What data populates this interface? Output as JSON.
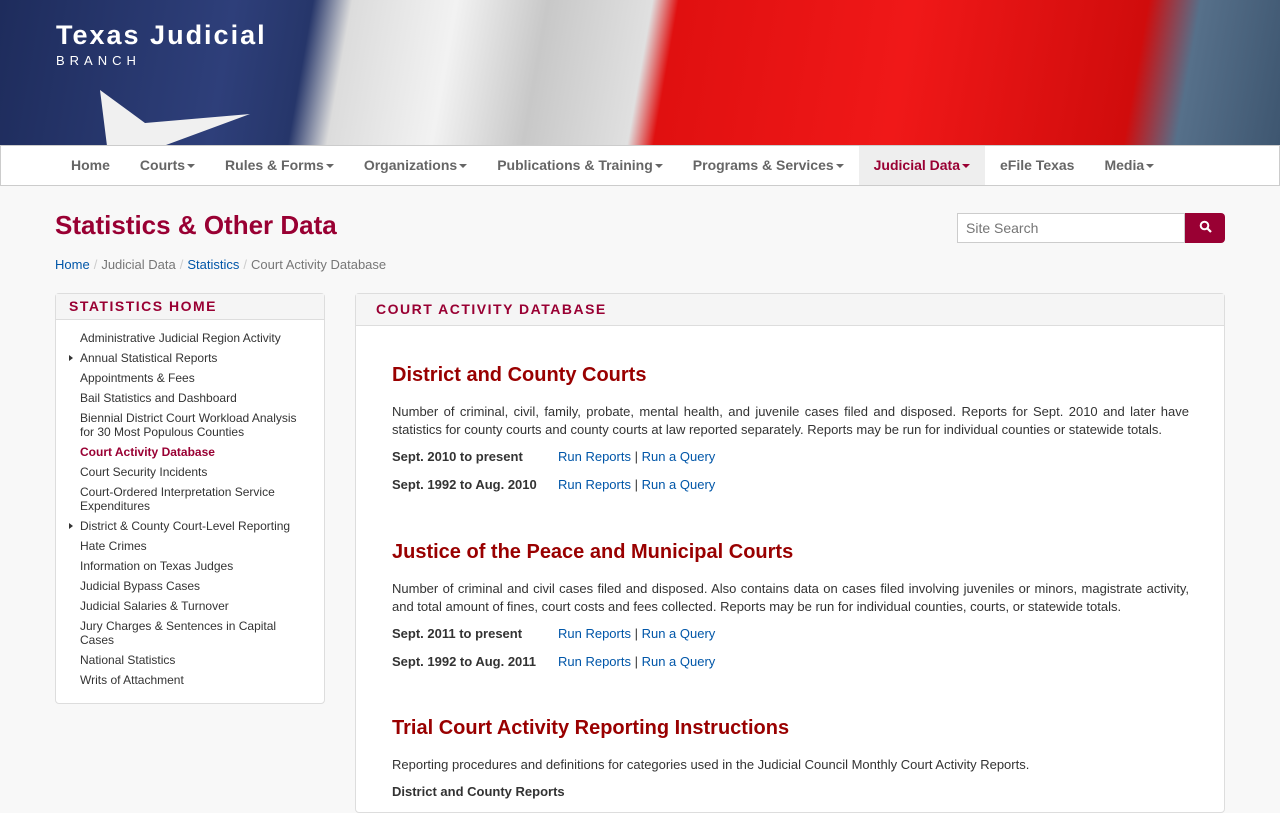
{
  "brand": {
    "title": "Texas Judicial",
    "subtitle": "BRANCH"
  },
  "nav": [
    {
      "label": "Home",
      "dropdown": false
    },
    {
      "label": "Courts",
      "dropdown": true
    },
    {
      "label": "Rules & Forms",
      "dropdown": true
    },
    {
      "label": "Organizations",
      "dropdown": true
    },
    {
      "label": "Publications & Training",
      "dropdown": true
    },
    {
      "label": "Programs & Services",
      "dropdown": true
    },
    {
      "label": "Judicial Data",
      "dropdown": true,
      "active": true
    },
    {
      "label": "eFile Texas",
      "dropdown": false
    },
    {
      "label": "Media",
      "dropdown": true
    }
  ],
  "page_title": "Statistics & Other Data",
  "search": {
    "placeholder": "Site Search",
    "icon": "search-icon"
  },
  "breadcrumb": [
    "Home",
    "Judicial Data",
    "Statistics",
    "Court Activity Database"
  ],
  "sidebar": {
    "heading": "STATISTICS HOME",
    "items": [
      "Administrative Judicial Region Activity",
      "Annual Statistical Reports",
      "Appointments & Fees",
      "Bail Statistics and Dashboard",
      "Biennial District Court Workload Analysis for 30 Most Populous Counties",
      "Court Activity Database",
      "Court Security Incidents",
      "Court-Ordered Interpretation Service Expenditures",
      "District & County Court-Level Reporting",
      "Hate Crimes",
      "Information on Texas Judges",
      "Judicial Bypass Cases",
      "Judicial Salaries & Turnover",
      "Jury Charges & Sentences in Capital Cases",
      "National Statistics",
      "Writs of Attachment"
    ]
  },
  "main": {
    "heading": "COURT ACTIVITY DATABASE",
    "sections": [
      {
        "title": "District and County Courts",
        "text": "Number of criminal, civil, family, probate, mental health, and juvenile cases filed and disposed. Reports for Sept. 2010 and later have statistics for county courts and county courts at law reported separately. Reports may be run for individual counties or statewide totals.",
        "rows": [
          {
            "label": "Sept. 2010 to present",
            "link1": "Run Reports",
            "link2": "Run a Query"
          },
          {
            "label": "Sept. 1992 to Aug. 2010",
            "link1": "Run Reports",
            "link2": "Run a Query"
          }
        ]
      },
      {
        "title": "Justice of the Peace and Municipal Courts",
        "text": "Number of criminal and civil cases filed and disposed. Also contains data on cases filed involving juveniles or minors, magistrate activity, and total amount of fines, court costs and fees collected. Reports may be run for individual counties, courts, or statewide totals.",
        "rows": [
          {
            "label": "Sept. 2011 to present",
            "link1": "Run Reports",
            "link2": "Run a Query"
          },
          {
            "label": "Sept. 1992 to Aug. 2011",
            "link1": "Run Reports",
            "link2": "Run a Query"
          }
        ]
      },
      {
        "title": "Trial Court Activity Reporting Instructions",
        "text": "Reporting procedures and definitions for categories used in the Judicial Council Monthly Court Activity Reports.",
        "subheading": "District and County Reports"
      }
    ]
  },
  "colors": {
    "accent": "#990033"
  }
}
